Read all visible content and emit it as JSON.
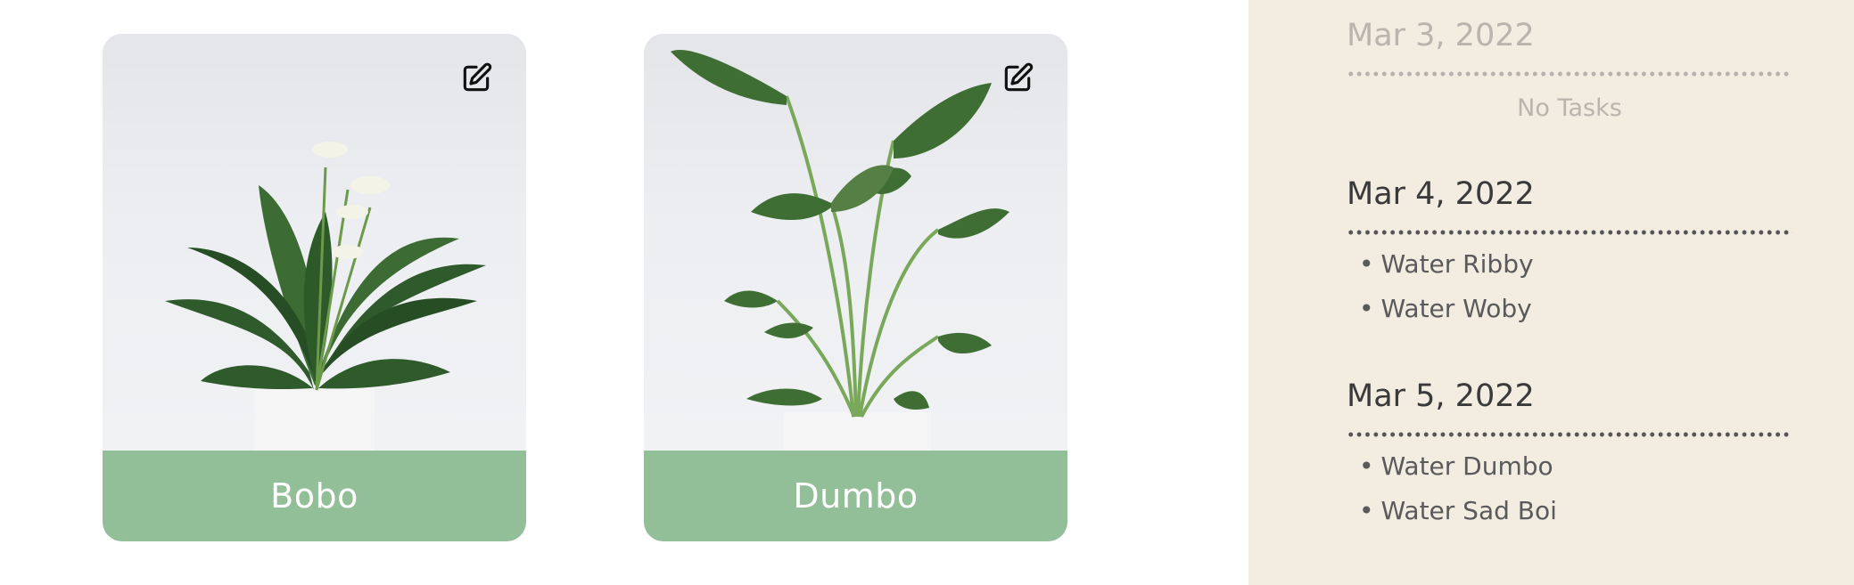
{
  "plants": [
    {
      "name": "Bobo",
      "edit_icon": "edit-icon"
    },
    {
      "name": "Dumbo",
      "edit_icon": "edit-icon"
    }
  ],
  "schedule": [
    {
      "date": "Mar 3, 2022",
      "empty_text": "No Tasks",
      "tasks": []
    },
    {
      "date": "Mar 4, 2022",
      "tasks": [
        "Water Ribby",
        "Water Woby"
      ]
    },
    {
      "date": "Mar 5, 2022",
      "tasks": [
        "Water Dumbo",
        "Water Sad Boi"
      ]
    }
  ],
  "bullet": "•",
  "colors": {
    "name_bar": "#92bf98",
    "sidebar_bg": "#f2ece1",
    "page_bg": "#ffffff"
  }
}
